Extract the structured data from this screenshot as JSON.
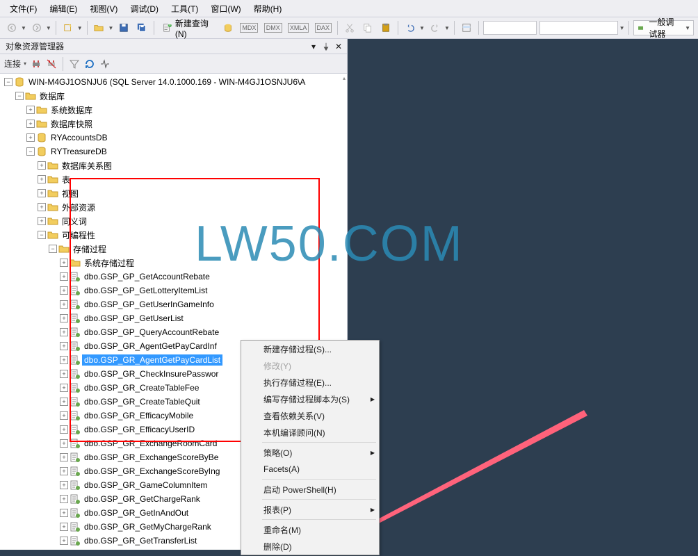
{
  "menu": {
    "file": "文件(F)",
    "edit": "编辑(E)",
    "view": "视图(V)",
    "debug": "调试(D)",
    "tools": "工具(T)",
    "window": "窗口(W)",
    "help": "帮助(H)"
  },
  "toolbar": {
    "newquery": "新建查询(N)",
    "dbicons": [
      "MDX",
      "DMX",
      "XMLA",
      "DAX"
    ],
    "debugger": "一般调试器"
  },
  "panel": {
    "title": "对象资源管理器",
    "connect": "连接"
  },
  "server": {
    "label": "WIN-M4GJ1OSNJU6 (SQL Server 14.0.1000.169 - WIN-M4GJ1OSNJU6\\A"
  },
  "tree": {
    "databases": "数据库",
    "sysdb": "系统数据库",
    "dbsnap": "数据库快照",
    "db1": "RYAccountsDB",
    "db2": "RYTreasureDB",
    "diagrams": "数据库关系图",
    "tables": "表",
    "views": "视图",
    "extres": "外部资源",
    "synonyms": "同义词",
    "prog": "可编程性",
    "sp": "存储过程",
    "syssp": "系统存储过程",
    "procs": [
      "dbo.GSP_GP_GetAccountRebate",
      "dbo.GSP_GP_GetLotteryItemList",
      "dbo.GSP_GP_GetUserInGameInfo",
      "dbo.GSP_GP_GetUserList",
      "dbo.GSP_GP_QueryAccountRebate",
      "dbo.GSP_GR_AgentGetPayCardInf",
      "dbo.GSP_GR_AgentGetPayCardList",
      "dbo.GSP_GR_CheckInsurePasswor",
      "dbo.GSP_GR_CreateTableFee",
      "dbo.GSP_GR_CreateTableQuit",
      "dbo.GSP_GR_EfficacyMobile",
      "dbo.GSP_GR_EfficacyUserID",
      "dbo.GSP_GR_ExchangeRoomCard",
      "dbo.GSP_GR_ExchangeScoreByBe",
      "dbo.GSP_GR_ExchangeScoreByIng",
      "dbo.GSP_GR_GameColumnItem",
      "dbo.GSP_GR_GetChargeRank",
      "dbo.GSP_GR_GetInAndOut",
      "dbo.GSP_GR_GetMyChargeRank",
      "dbo.GSP_GR_GetTransferList"
    ]
  },
  "context": {
    "newsp": "新建存储过程(S)...",
    "modify": "修改(Y)",
    "exec": "执行存储过程(E)...",
    "script": "编写存储过程脚本为(S)",
    "viewdep": "查看依赖关系(V)",
    "native": "本机编译顾问(N)",
    "policy": "策略(O)",
    "facets": "Facets(A)",
    "powershell": "启动 PowerShell(H)",
    "reports": "报表(P)",
    "rename": "重命名(M)",
    "delete": "删除(D)"
  },
  "watermark": "LW50.COM"
}
